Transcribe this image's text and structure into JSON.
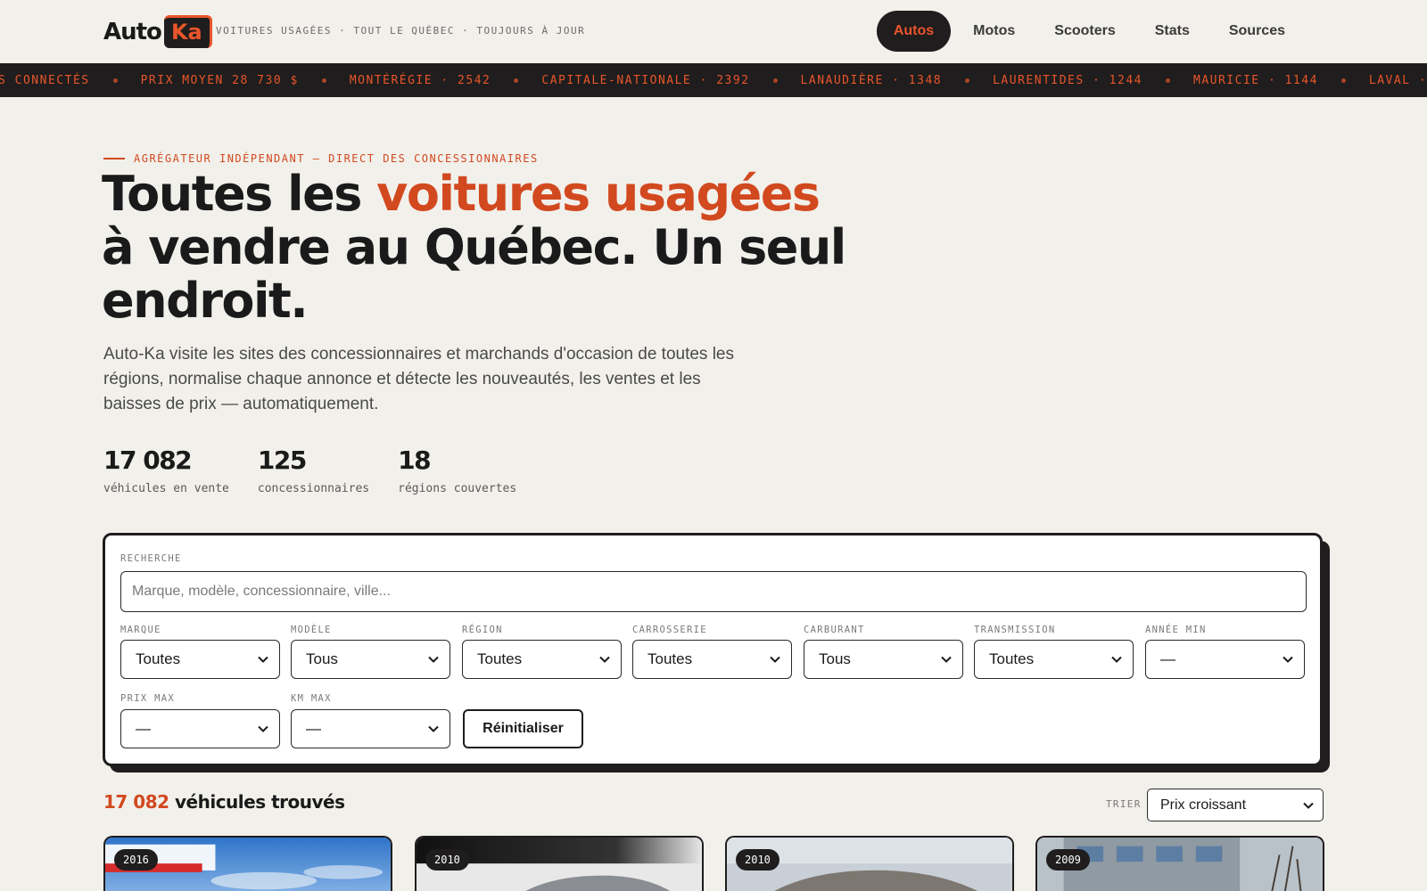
{
  "header": {
    "logo_main": "Auto",
    "logo_badge": "Ka",
    "tagline": "VOITURES USAGÉES · TOUT LE QUÉBEC · TOUJOURS À JOUR",
    "nav": [
      {
        "label": "Autos",
        "active": true
      },
      {
        "label": "Motos",
        "active": false
      },
      {
        "label": "Scooters",
        "active": false
      },
      {
        "label": "Stats",
        "active": false
      },
      {
        "label": "Sources",
        "active": false
      }
    ]
  },
  "ticker": [
    "S CONNECTÉS",
    "PRIX MOYEN 28 730 $",
    "MONTÉRÉGIE · 2542",
    "CAPITALE-NATIONALE · 2392",
    "LANAUDIÈRE · 1348",
    "LAURENTIDES · 1244",
    "MAURICIE · 1144",
    "LAVAL · 1023"
  ],
  "hero": {
    "eyebrow": "AGRÉGATEUR INDÉPENDANT — DIRECT DES CONCESSIONNAIRES",
    "title_before": "Toutes les ",
    "title_accent": "voitures usagées",
    "title_after": " à vendre au Québec. Un seul endroit.",
    "description": "Auto-Ka visite les sites des concessionnaires et marchands d'occasion de toutes les régions, normalise chaque annonce et détecte les nouveautés, les ventes et les baisses de prix — automatiquement.",
    "stats": [
      {
        "value": "17 082",
        "label": "véhicules en vente"
      },
      {
        "value": "125",
        "label": "concessionnaires"
      },
      {
        "value": "18",
        "label": "régions couvertes"
      }
    ]
  },
  "search": {
    "label": "RECHERCHE",
    "placeholder": "Marque, modèle, concessionnaire, ville...",
    "filters": [
      {
        "label": "MARQUE",
        "value": "Toutes"
      },
      {
        "label": "MODÈLE",
        "value": "Tous"
      },
      {
        "label": "RÉGION",
        "value": "Toutes"
      },
      {
        "label": "CARROSSERIE",
        "value": "Toutes"
      },
      {
        "label": "CARBURANT",
        "value": "Tous"
      },
      {
        "label": "TRANSMISSION",
        "value": "Toutes"
      },
      {
        "label": "ANNÉE MIN",
        "value": "—"
      },
      {
        "label": "PRIX MAX",
        "value": "—"
      },
      {
        "label": "KM MAX",
        "value": "—"
      }
    ],
    "reset_label": "Réinitialiser"
  },
  "results": {
    "count": "17 082",
    "count_suffix": " véhicules trouvés",
    "sort_label": "TRIER",
    "sort_value": "Prix croissant"
  },
  "cards": [
    {
      "year": "2016"
    },
    {
      "year": "2010"
    },
    {
      "year": "2010"
    },
    {
      "year": "2009"
    }
  ],
  "colors": {
    "accent": "#d2491f",
    "dark": "#1f1d1d",
    "background": "#f2f0eb"
  }
}
